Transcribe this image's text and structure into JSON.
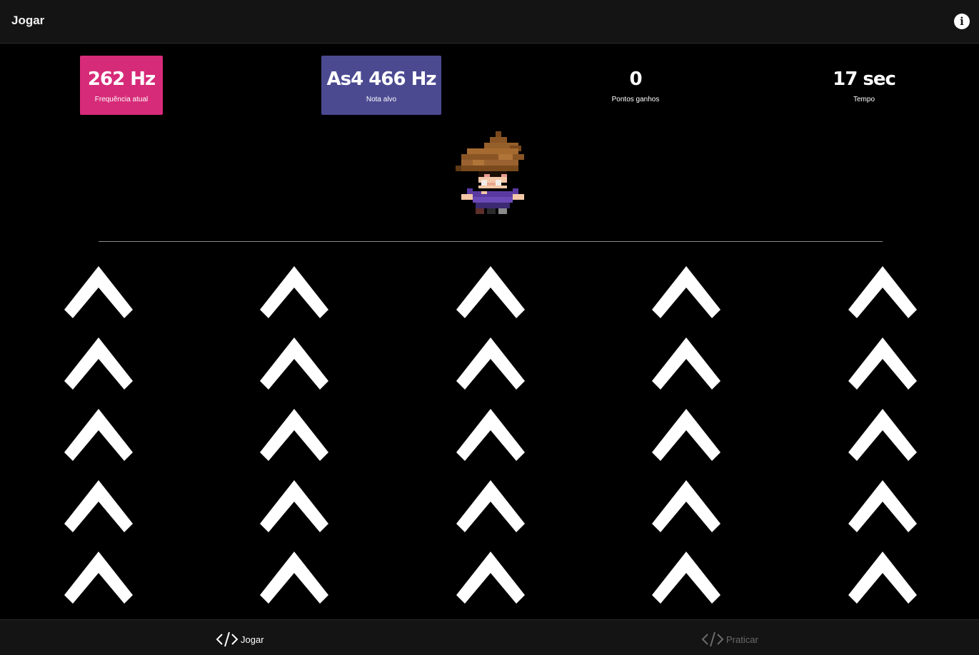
{
  "header": {
    "title": "Jogar",
    "info_icon": "info-icon",
    "info_glyph": "i"
  },
  "stats": {
    "frequency": {
      "value": "262 Hz",
      "label": "Frequência atual",
      "color": "#d62b78"
    },
    "target": {
      "value": "As4 466 Hz",
      "label": "Nota alvo",
      "color": "#4b4a91"
    },
    "points": {
      "value": "0",
      "label": "Pontos ganhos"
    },
    "time": {
      "value": "17 sec",
      "label": "Tempo"
    }
  },
  "arrows": {
    "columns": 5,
    "rows": 5,
    "icon": "chevron-up-icon",
    "color": "#ffffff"
  },
  "footer": {
    "tabs": [
      {
        "label": "Jogar",
        "icon": "code-icon",
        "active": true
      },
      {
        "label": "Praticar",
        "icon": "code-icon",
        "active": false
      }
    ]
  }
}
